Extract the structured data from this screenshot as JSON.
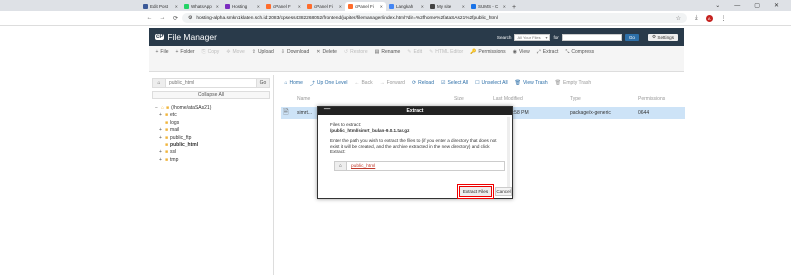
{
  "browser": {
    "tabs": [
      {
        "label": "Edit Post",
        "color": "#3b5998"
      },
      {
        "label": "WhatsApp",
        "color": "#25d366"
      },
      {
        "label": "Hosting",
        "color": "#7b2cbf"
      },
      {
        "label": "cPanel F",
        "color": "#ff6c2c"
      },
      {
        "label": "cPanel Fi",
        "color": "#ff6c2c"
      },
      {
        "label": "cPanel Fi",
        "color": "#ff6c2c",
        "active": true
      },
      {
        "label": "Langkah",
        "color": "#4285f4"
      },
      {
        "label": "My site",
        "color": "#444444"
      },
      {
        "label": "SUMS - C",
        "color": "#1a73e8"
      }
    ],
    "close_glyph": "✕",
    "new_tab": "+",
    "window_controls": [
      "⌄",
      "—",
      "▢",
      "✕"
    ],
    "address": "hosting-alpha.smkn1klaten.sch.id:2083/cpsess4382268052/frontend/jupiter/filemanager/index.html?dir=%2fhome%2fataSAs21%2fpublic_html",
    "avatar_letter": "A"
  },
  "fm": {
    "title": "File Manager",
    "search_label": "Search",
    "search_scope": "All Your Files",
    "for_label": "for",
    "go_label": "Go",
    "settings_label": "Settings",
    "toolbar": [
      {
        "label": "File",
        "icon": "+",
        "icon_name": "plus-icon",
        "disabled": false
      },
      {
        "label": "Folder",
        "icon": "+",
        "icon_name": "plus-icon",
        "disabled": false
      },
      {
        "label": "Copy",
        "icon": "⎘",
        "icon_name": "copy-icon",
        "disabled": true
      },
      {
        "label": "Move",
        "icon": "✥",
        "icon_name": "move-icon",
        "disabled": true
      },
      {
        "label": "Upload",
        "icon": "⇪",
        "icon_name": "upload-icon",
        "disabled": false
      },
      {
        "label": "Download",
        "icon": "⇩",
        "icon_name": "download-icon",
        "disabled": false
      },
      {
        "label": "Delete",
        "icon": "✕",
        "icon_name": "delete-icon",
        "disabled": false
      },
      {
        "label": "Restore",
        "icon": "↺",
        "icon_name": "restore-icon",
        "disabled": true
      },
      {
        "label": "Rename",
        "icon": "▤",
        "icon_name": "rename-icon",
        "disabled": false
      },
      {
        "label": "Edit",
        "icon": "✎",
        "icon_name": "edit-icon",
        "disabled": true
      },
      {
        "label": "HTML Editor",
        "icon": "✎",
        "icon_name": "html-editor-icon",
        "disabled": true
      },
      {
        "label": "Permissions",
        "icon": "🔑",
        "icon_name": "key-icon",
        "disabled": false
      },
      {
        "label": "View",
        "icon": "◉",
        "icon_name": "eye-icon",
        "disabled": false
      },
      {
        "label": "Extract",
        "icon": "⤢",
        "icon_name": "extract-icon",
        "disabled": false
      },
      {
        "label": "Compress",
        "icon": "⤡",
        "icon_name": "compress-icon",
        "disabled": false
      }
    ],
    "path_value": "public_html",
    "path_go": "Go",
    "collapse_all": "Collapse All",
    "tree": [
      {
        "label": "(/home/ataSAs21)",
        "indent": 0,
        "toggle": "−",
        "bold": false
      },
      {
        "label": "etc",
        "indent": 1,
        "toggle": "+",
        "bold": false
      },
      {
        "label": "logs",
        "indent": 1,
        "toggle": "",
        "bold": false
      },
      {
        "label": "mail",
        "indent": 1,
        "toggle": "+",
        "bold": false
      },
      {
        "label": "public_ftp",
        "indent": 1,
        "toggle": "+",
        "bold": false
      },
      {
        "label": "public_html",
        "indent": 1,
        "toggle": "",
        "bold": true
      },
      {
        "label": "ssl",
        "indent": 1,
        "toggle": "+",
        "bold": false
      },
      {
        "label": "tmp",
        "indent": 1,
        "toggle": "+",
        "bold": false
      }
    ],
    "nav": [
      {
        "label": "Home",
        "icon": "⌂",
        "icon_name": "home-icon",
        "disabled": false
      },
      {
        "label": "Up One Level",
        "icon": "⤴",
        "icon_name": "up-level-icon",
        "disabled": false
      },
      {
        "label": "Back",
        "icon": "←",
        "icon_name": "back-icon",
        "disabled": true
      },
      {
        "label": "Forward",
        "icon": "→",
        "icon_name": "forward-icon",
        "disabled": true
      },
      {
        "label": "Reload",
        "icon": "⟳",
        "icon_name": "reload-icon",
        "disabled": false
      },
      {
        "label": "Select All",
        "icon": "☑",
        "icon_name": "select-all-icon",
        "disabled": false
      },
      {
        "label": "Unselect All",
        "icon": "☐",
        "icon_name": "unselect-all-icon",
        "disabled": false
      },
      {
        "label": "View Trash",
        "icon": "🗑",
        "icon_name": "trash-icon",
        "disabled": false
      },
      {
        "label": "Empty Trash",
        "icon": "🗑",
        "icon_name": "empty-trash-icon",
        "disabled": true
      }
    ],
    "columns": [
      "Name",
      "Size",
      "Last Modified",
      "Type",
      "Permissions"
    ],
    "file_row": {
      "name": "simrt...",
      "modified": "1:58 PM",
      "type": "package/x-generic",
      "perms": "0644"
    }
  },
  "modal": {
    "title": "Extract",
    "files_label": "Files to extract:",
    "file_path": "/public_html/simrt_bulan-9.0.1.tar.gz",
    "instruction": "Enter the path you wish to extract the files to (if you enter a directory that does not exist it will be created, and the archive extracted in the new directory) and click Extract:",
    "dest_value": "public_html",
    "extract_label": "Extract Files",
    "cancel_label": "Cancel"
  }
}
